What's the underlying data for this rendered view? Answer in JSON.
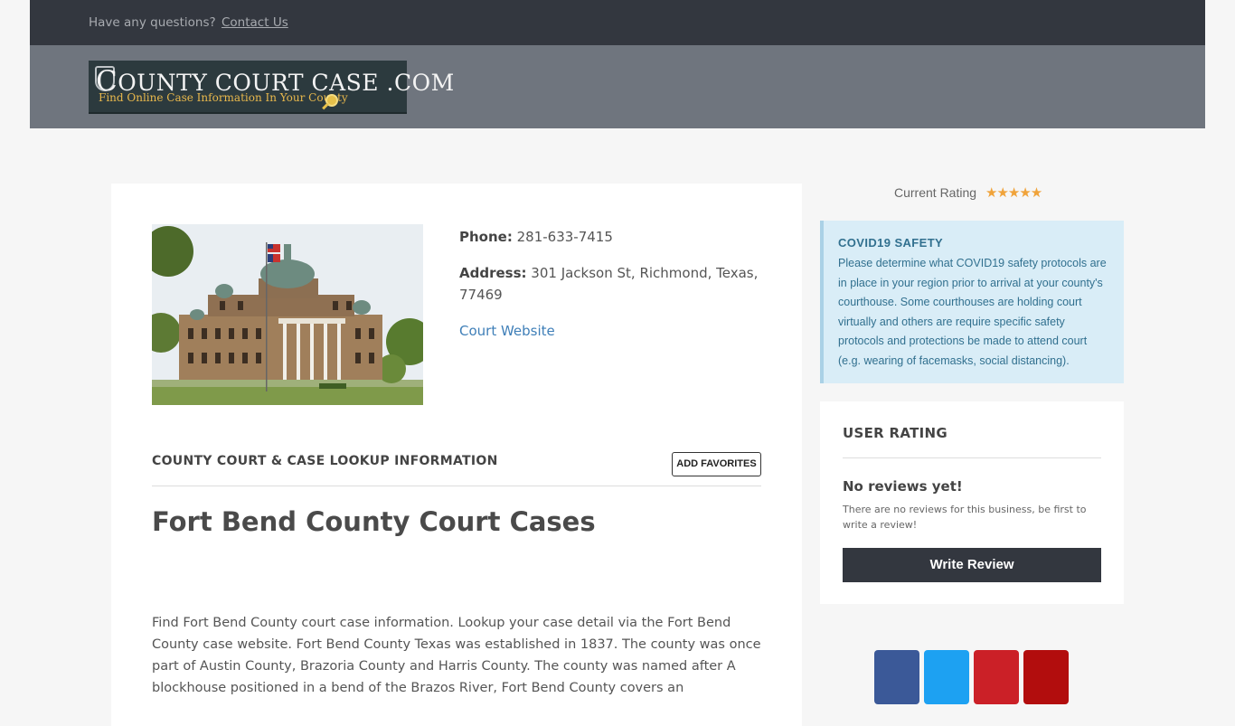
{
  "topbar": {
    "question": "Have any questions?",
    "contact_label": "Contact Us"
  },
  "logo": {
    "title_first": "C",
    "title_rest": "OUNTY COURT CASE .COM",
    "tagline": "Find Online Case Information In Your County"
  },
  "court": {
    "phone_label": "Phone:",
    "phone": "281-633-7415",
    "address_label": "Address:",
    "address": "301 Jackson St, Richmond, Texas, 77469",
    "website_label": "Court Website"
  },
  "section": {
    "title": "COUNTY COURT & CASE LOOKUP INFORMATION",
    "favorites_label": "ADD FAVORITES"
  },
  "page_title": "Fort Bend County Court Cases",
  "description": "Find Fort Bend County court case information. Lookup your case detail via the Fort Bend County case website. Fort Bend County Texas was established in 1837. The county was once part of Austin County, Brazoria County and Harris County. The county was named after A blockhouse positioned in a bend of the Brazos River, Fort Bend County covers an",
  "sidebar": {
    "current_rating_label": "Current Rating",
    "stars": "★★★★★",
    "covid": {
      "heading": "COVID19 SAFETY",
      "text": "Please determine what COVID19 safety protocols are in place in your region prior to arrival at your county's courthouse. Some courthouses are holding court virtually and others are require specific safety protocols and protections be made to attend court (e.g. wearing of facemasks, social distancing)."
    },
    "user_rating": {
      "heading": "USER RATING",
      "no_reviews": "No reviews yet!",
      "sub": "There are no reviews for this business, be first to write a review!",
      "button": "Write Review"
    }
  },
  "colors": {
    "topbar": "#33373f",
    "header": "#6f757e",
    "link": "#3f7fb8",
    "covid_bg": "#d9edf7",
    "star": "#f0a33a",
    "share_facebook": "#3b5998",
    "share_twitter": "#1da1f2",
    "share_pinterest": "#cb2027",
    "share_other": "#b20d0d"
  }
}
